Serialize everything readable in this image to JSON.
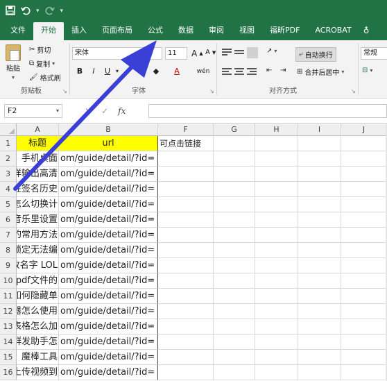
{
  "quick_access": {
    "save_icon": "save-icon",
    "undo_icon": "undo-icon",
    "redo_icon": "redo-icon",
    "customize_icon": "customize-icon"
  },
  "tabs": [
    {
      "label": "文件",
      "active": false
    },
    {
      "label": "开始",
      "active": true
    },
    {
      "label": "插入",
      "active": false
    },
    {
      "label": "页面布局",
      "active": false
    },
    {
      "label": "公式",
      "active": false
    },
    {
      "label": "数据",
      "active": false
    },
    {
      "label": "审阅",
      "active": false
    },
    {
      "label": "视图",
      "active": false
    },
    {
      "label": "福昕PDF",
      "active": false
    },
    {
      "label": "ACROBAT",
      "active": false
    }
  ],
  "ribbon": {
    "clipboard": {
      "paste": "粘贴",
      "cut": "剪切",
      "copy": "复制",
      "format_painter": "格式刷",
      "group_label": "剪贴板"
    },
    "font": {
      "font_name": "宋体",
      "font_size": "11",
      "bold": "B",
      "italic": "I",
      "underline": "U",
      "font_color_letter": "A",
      "phonetic": "wén",
      "group_label": "字体"
    },
    "alignment": {
      "wrap_text": "自动换行",
      "merge_center": "合并后居中",
      "group_label": "对齐方式"
    },
    "number": {
      "format": "常规"
    }
  },
  "formula_bar": {
    "name_box": "F2",
    "fx": "fx"
  },
  "grid": {
    "columns": [
      "A",
      "B",
      "F",
      "G",
      "H",
      "I",
      "J"
    ],
    "header_row": {
      "row": "1",
      "a": "标题",
      "b": "url",
      "f": "可点击链接"
    },
    "rows": [
      {
        "row": "2",
        "a": "手机桌面",
        "b": "om/guide/detail/?id="
      },
      {
        "row": "3",
        "a": "样输出高清",
        "b": "om/guide/detail/?id="
      },
      {
        "row": "4",
        "a": "性签名历史",
        "b": "om/guide/detail/?id="
      },
      {
        "row": "5",
        "a": "么怎么切换计",
        "b": "om/guide/detail/?id="
      },
      {
        "row": "6",
        "a": "音乐里设置",
        "b": "om/guide/detail/?id="
      },
      {
        "row": "7",
        "a": "的常用方法",
        "b": "om/guide/detail/?id="
      },
      {
        "row": "8",
        "a": "锁定无法编",
        "b": "om/guide/detail/?id="
      },
      {
        "row": "9",
        "a": "改名字 LOL",
        "b": "om/guide/detail/?id="
      },
      {
        "row": "10",
        "a": "pdf文件的",
        "b": "om/guide/detail/?id="
      },
      {
        "row": "11",
        "a": "如何隐藏单",
        "b": "om/guide/detail/?id="
      },
      {
        "row": "12",
        "a": "器怎么使用",
        "b": "om/guide/detail/?id="
      },
      {
        "row": "13",
        "a": "表格怎么加",
        "b": "om/guide/detail/?id="
      },
      {
        "row": "14",
        "a": "群发助手怎",
        "b": "om/guide/detail/?id="
      },
      {
        "row": "15",
        "a": "魔棒工具",
        "b": "om/guide/detail/?id="
      },
      {
        "row": "16",
        "a": "上传视频到",
        "b": "om/guide/detail/?id="
      }
    ]
  },
  "colors": {
    "excel_green": "#217346",
    "header_yellow": "#ffff00",
    "arrow_blue": "#3a3fd6"
  }
}
